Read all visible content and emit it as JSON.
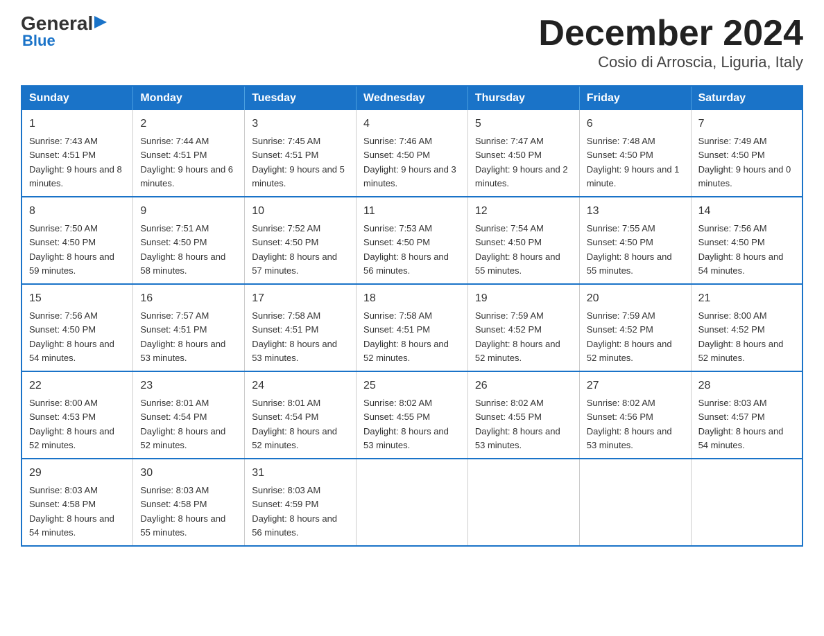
{
  "logo": {
    "general": "General",
    "blue": "Blue",
    "triangle": "▶"
  },
  "title": "December 2024",
  "subtitle": "Cosio di Arroscia, Liguria, Italy",
  "days_of_week": [
    "Sunday",
    "Monday",
    "Tuesday",
    "Wednesday",
    "Thursday",
    "Friday",
    "Saturday"
  ],
  "weeks": [
    [
      {
        "day": "1",
        "sunrise": "7:43 AM",
        "sunset": "4:51 PM",
        "daylight": "9 hours and 8 minutes."
      },
      {
        "day": "2",
        "sunrise": "7:44 AM",
        "sunset": "4:51 PM",
        "daylight": "9 hours and 6 minutes."
      },
      {
        "day": "3",
        "sunrise": "7:45 AM",
        "sunset": "4:51 PM",
        "daylight": "9 hours and 5 minutes."
      },
      {
        "day": "4",
        "sunrise": "7:46 AM",
        "sunset": "4:50 PM",
        "daylight": "9 hours and 3 minutes."
      },
      {
        "day": "5",
        "sunrise": "7:47 AM",
        "sunset": "4:50 PM",
        "daylight": "9 hours and 2 minutes."
      },
      {
        "day": "6",
        "sunrise": "7:48 AM",
        "sunset": "4:50 PM",
        "daylight": "9 hours and 1 minute."
      },
      {
        "day": "7",
        "sunrise": "7:49 AM",
        "sunset": "4:50 PM",
        "daylight": "9 hours and 0 minutes."
      }
    ],
    [
      {
        "day": "8",
        "sunrise": "7:50 AM",
        "sunset": "4:50 PM",
        "daylight": "8 hours and 59 minutes."
      },
      {
        "day": "9",
        "sunrise": "7:51 AM",
        "sunset": "4:50 PM",
        "daylight": "8 hours and 58 minutes."
      },
      {
        "day": "10",
        "sunrise": "7:52 AM",
        "sunset": "4:50 PM",
        "daylight": "8 hours and 57 minutes."
      },
      {
        "day": "11",
        "sunrise": "7:53 AM",
        "sunset": "4:50 PM",
        "daylight": "8 hours and 56 minutes."
      },
      {
        "day": "12",
        "sunrise": "7:54 AM",
        "sunset": "4:50 PM",
        "daylight": "8 hours and 55 minutes."
      },
      {
        "day": "13",
        "sunrise": "7:55 AM",
        "sunset": "4:50 PM",
        "daylight": "8 hours and 55 minutes."
      },
      {
        "day": "14",
        "sunrise": "7:56 AM",
        "sunset": "4:50 PM",
        "daylight": "8 hours and 54 minutes."
      }
    ],
    [
      {
        "day": "15",
        "sunrise": "7:56 AM",
        "sunset": "4:50 PM",
        "daylight": "8 hours and 54 minutes."
      },
      {
        "day": "16",
        "sunrise": "7:57 AM",
        "sunset": "4:51 PM",
        "daylight": "8 hours and 53 minutes."
      },
      {
        "day": "17",
        "sunrise": "7:58 AM",
        "sunset": "4:51 PM",
        "daylight": "8 hours and 53 minutes."
      },
      {
        "day": "18",
        "sunrise": "7:58 AM",
        "sunset": "4:51 PM",
        "daylight": "8 hours and 52 minutes."
      },
      {
        "day": "19",
        "sunrise": "7:59 AM",
        "sunset": "4:52 PM",
        "daylight": "8 hours and 52 minutes."
      },
      {
        "day": "20",
        "sunrise": "7:59 AM",
        "sunset": "4:52 PM",
        "daylight": "8 hours and 52 minutes."
      },
      {
        "day": "21",
        "sunrise": "8:00 AM",
        "sunset": "4:52 PM",
        "daylight": "8 hours and 52 minutes."
      }
    ],
    [
      {
        "day": "22",
        "sunrise": "8:00 AM",
        "sunset": "4:53 PM",
        "daylight": "8 hours and 52 minutes."
      },
      {
        "day": "23",
        "sunrise": "8:01 AM",
        "sunset": "4:54 PM",
        "daylight": "8 hours and 52 minutes."
      },
      {
        "day": "24",
        "sunrise": "8:01 AM",
        "sunset": "4:54 PM",
        "daylight": "8 hours and 52 minutes."
      },
      {
        "day": "25",
        "sunrise": "8:02 AM",
        "sunset": "4:55 PM",
        "daylight": "8 hours and 53 minutes."
      },
      {
        "day": "26",
        "sunrise": "8:02 AM",
        "sunset": "4:55 PM",
        "daylight": "8 hours and 53 minutes."
      },
      {
        "day": "27",
        "sunrise": "8:02 AM",
        "sunset": "4:56 PM",
        "daylight": "8 hours and 53 minutes."
      },
      {
        "day": "28",
        "sunrise": "8:03 AM",
        "sunset": "4:57 PM",
        "daylight": "8 hours and 54 minutes."
      }
    ],
    [
      {
        "day": "29",
        "sunrise": "8:03 AM",
        "sunset": "4:58 PM",
        "daylight": "8 hours and 54 minutes."
      },
      {
        "day": "30",
        "sunrise": "8:03 AM",
        "sunset": "4:58 PM",
        "daylight": "8 hours and 55 minutes."
      },
      {
        "day": "31",
        "sunrise": "8:03 AM",
        "sunset": "4:59 PM",
        "daylight": "8 hours and 56 minutes."
      },
      null,
      null,
      null,
      null
    ]
  ]
}
